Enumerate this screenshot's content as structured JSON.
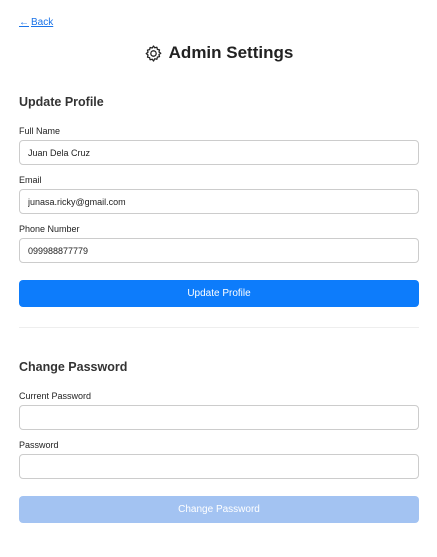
{
  "nav": {
    "back_arrow": "←",
    "back_label": "Back"
  },
  "header": {
    "icon": "gear-icon",
    "title": "Admin Settings"
  },
  "profile": {
    "section_title": "Update Profile",
    "full_name_label": "Full Name",
    "full_name_value": "Juan Dela Cruz",
    "email_label": "Email",
    "email_value": "junasa.ricky@gmail.com",
    "phone_label": "Phone Number",
    "phone_value": "099988877779",
    "submit_label": "Update Profile"
  },
  "password": {
    "section_title": "Change Password",
    "current_label": "Current Password",
    "current_value": "",
    "new_label": "Password",
    "new_value": "",
    "submit_label": "Change Password"
  },
  "colors": {
    "primary": "#0d7cfb",
    "disabled": "#a3c3f2",
    "link": "#1a73e8"
  }
}
